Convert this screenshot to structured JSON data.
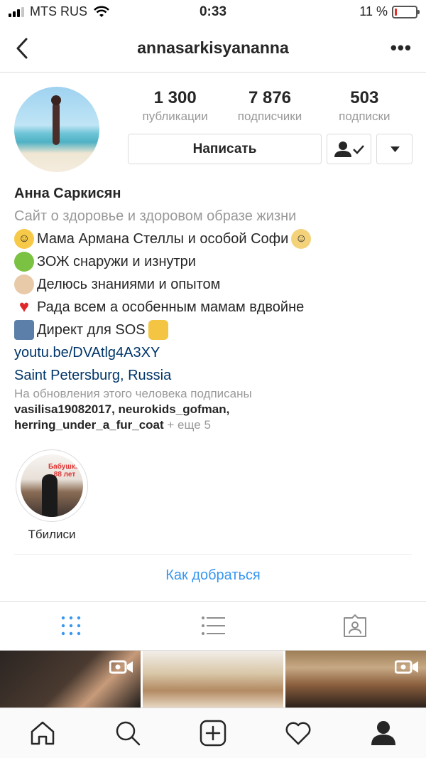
{
  "status_bar": {
    "carrier": "MTS RUS",
    "time": "0:33",
    "battery": "11 %",
    "battery_level": 0.11
  },
  "navbar": {
    "title": "annasarkisyananna",
    "more_label": "•••"
  },
  "stats": [
    {
      "value": "1 300",
      "label": "публикации"
    },
    {
      "value": "7 876",
      "label": "подписчики"
    },
    {
      "value": "503",
      "label": "подписки"
    }
  ],
  "actions": {
    "message_label": "Написать"
  },
  "bio": {
    "name": "Анна Саркисян",
    "category": "Сайт о здоровье и здоровом образе жизни",
    "lines": [
      {
        "emoji": "hugging-face",
        "text": "Мама Армана Стеллы и особой Софи",
        "emoji_after": "baby-angel"
      },
      {
        "emoji": "green-apple",
        "text": "ЗОЖ снаружи и изнутри"
      },
      {
        "emoji": "woman-with-crown",
        "text": "Делюсь знаниями и опытом"
      },
      {
        "emoji": "red-heart",
        "text": "Рада всем а особенным мамам вдвойне"
      },
      {
        "emoji": "mailbox",
        "text": "Директ для SOS",
        "emoji_after": "folded-hands"
      }
    ],
    "link": "youtu.be/DVAtlg4A3XY",
    "location": "Saint Petersburg, Russia"
  },
  "followed_by": {
    "header": "На обновления этого человека подписаны",
    "users_line1": "vasilisa19082017, neurokids_gofman,",
    "users_line2": "herring_under_a_fur_coat",
    "more": " + еще 5"
  },
  "highlights": [
    {
      "label": "Тбилиси",
      "overlay": "Бабушк... 88 лет"
    }
  ],
  "directions_label": "Как добраться",
  "colors": {
    "link": "#003569",
    "accent": "#3897f0",
    "muted": "#999999",
    "divider": "#dbdbdb"
  }
}
